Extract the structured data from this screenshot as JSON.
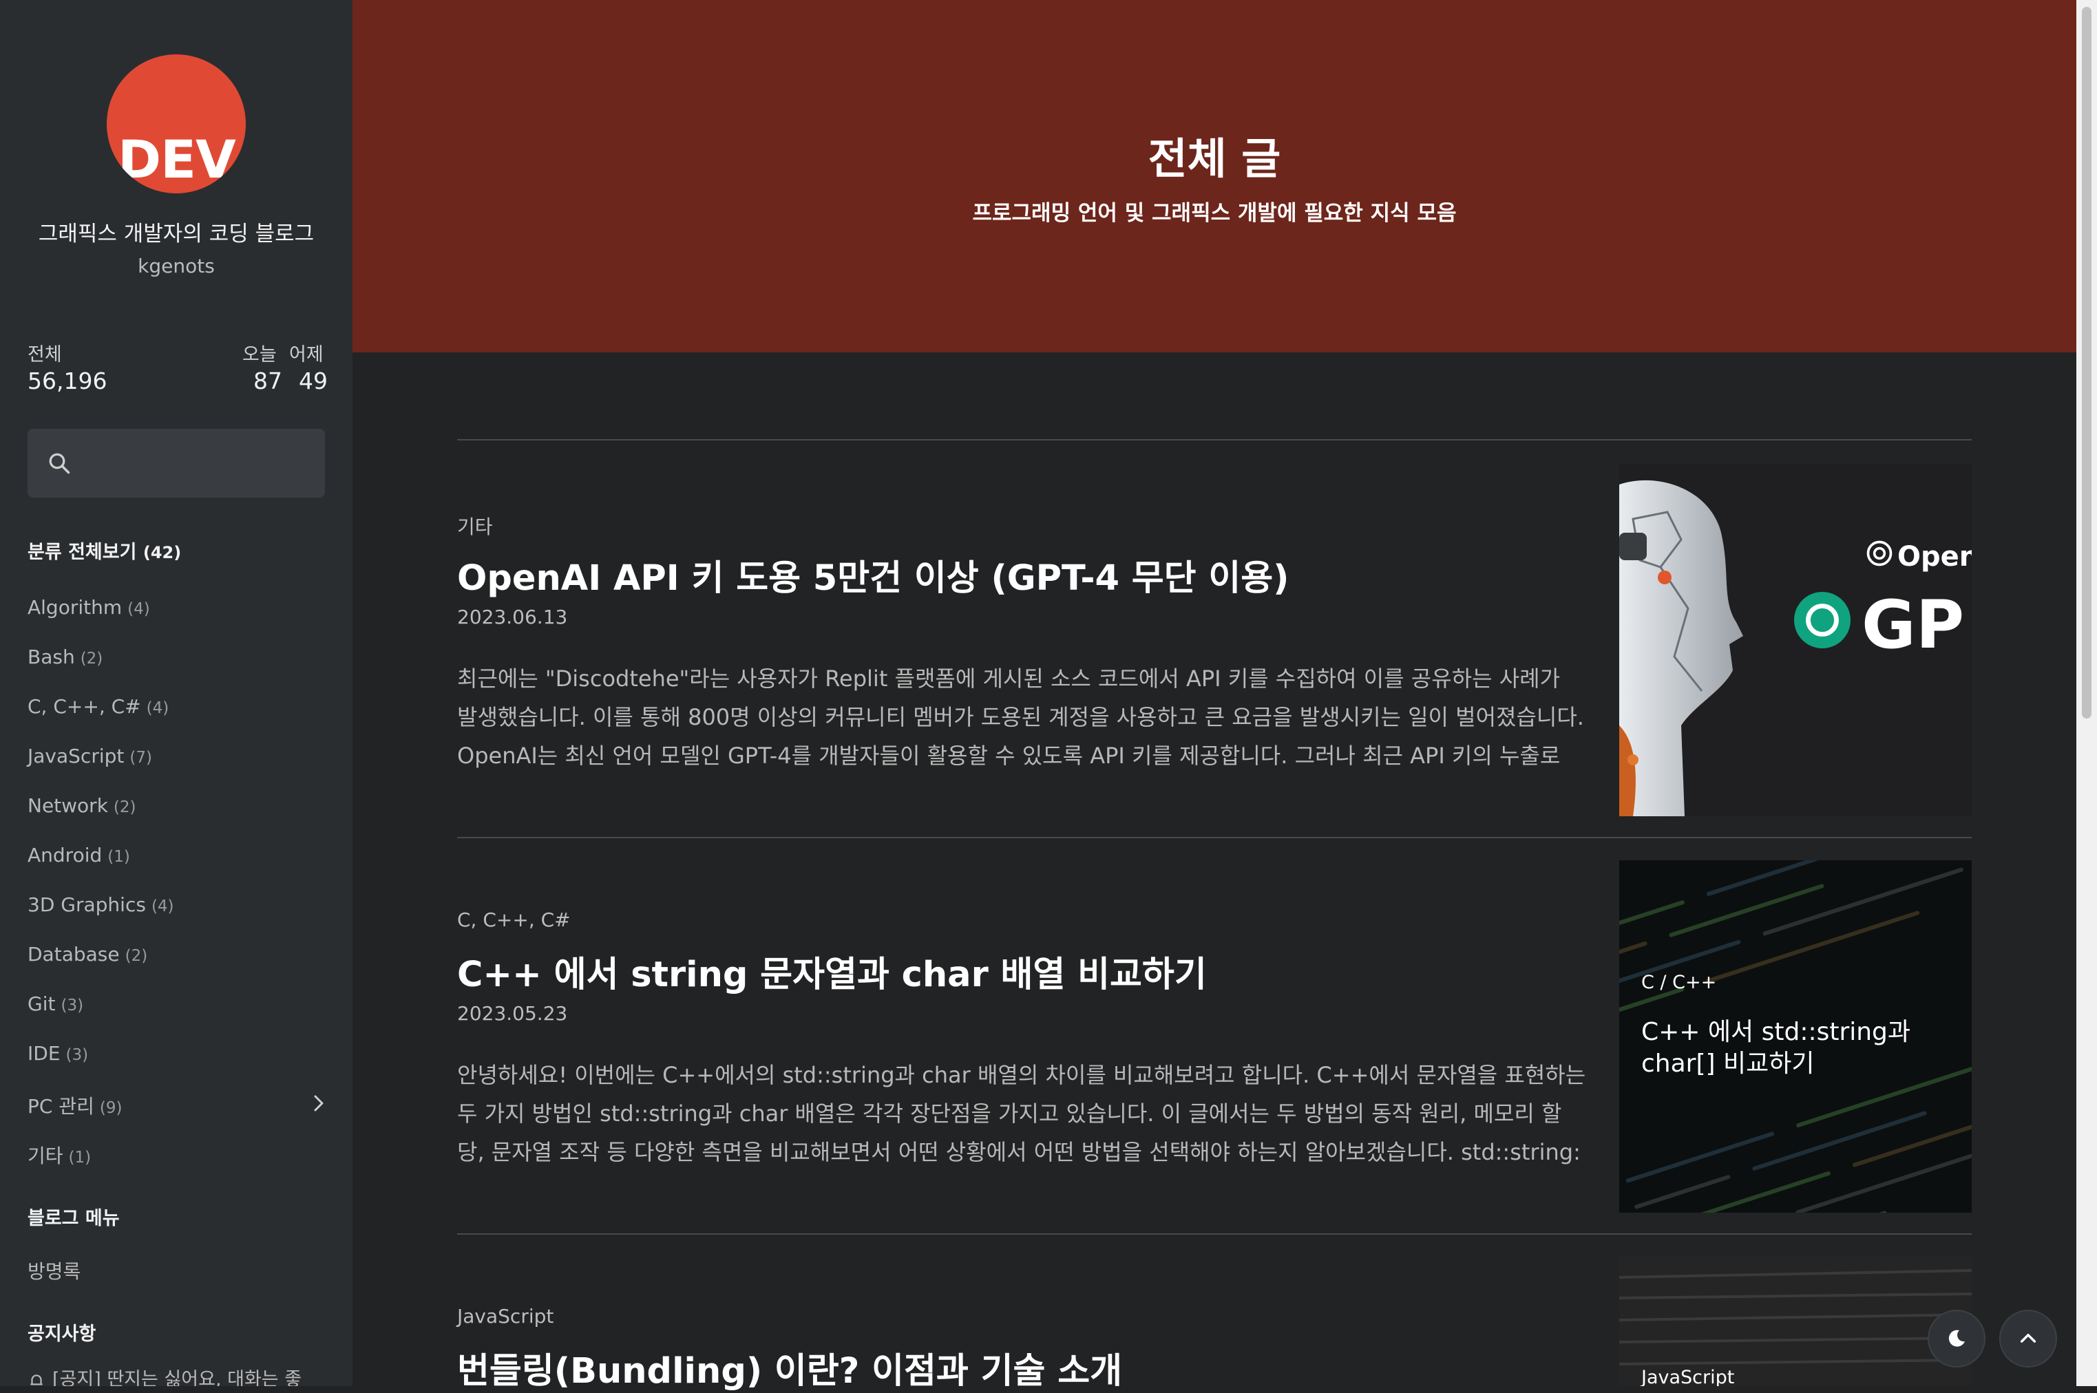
{
  "sidebar": {
    "logo_text": "DEV",
    "blog_title": "그래픽스 개발자의 코딩 블로그",
    "author": "kgenots",
    "stats": {
      "total_label": "전체",
      "total_value": "56,196",
      "today_label": "오늘",
      "today_value": "87",
      "yesterday_label": "어제",
      "yesterday_value": "49"
    },
    "search_icon": "search-icon",
    "categories_header": "분류 전체보기",
    "categories_total": "(42)",
    "categories": [
      {
        "name": "Algorithm",
        "count": "(4)"
      },
      {
        "name": "Bash",
        "count": "(2)"
      },
      {
        "name": "C, C++, C#",
        "count": "(4)"
      },
      {
        "name": "JavaScript",
        "count": "(7)"
      },
      {
        "name": "Network",
        "count": "(2)"
      },
      {
        "name": "Android",
        "count": "(1)"
      },
      {
        "name": "3D Graphics",
        "count": "(4)"
      },
      {
        "name": "Database",
        "count": "(2)"
      },
      {
        "name": "Git",
        "count": "(3)"
      },
      {
        "name": "IDE",
        "count": "(3)"
      },
      {
        "name": "PC 관리",
        "count": "(9)"
      },
      {
        "name": "기타",
        "count": "(1)"
      }
    ],
    "menu_header": "블로그 메뉴",
    "menu_items": [
      "방명록"
    ],
    "notice_header": "공지사항",
    "notice_item": "[공지] 딴지는 싫어요, 대화는 좋"
  },
  "header": {
    "title": "전체 글",
    "subtitle": "프로그래밍 언어 및 그래픽스 개발에 필요한 지식 모음",
    "color": "#6d261c"
  },
  "posts": [
    {
      "category": "기타",
      "title": "OpenAI API 키 도용 5만건 이상 (GPT-4 무단 이용)",
      "date": "2023.06.13",
      "excerpt": "최근에는 \"Discodtehe\"라는 사용자가 Replit 플랫폼에 게시된 소스 코드에서 API 키를 수집하여 이를 공유하는 사례가 발생했습니다. 이를 통해 800명 이상의 커뮤니티 멤버가 도용된 계정을 사용하고 큰 요금을 발생시키는 일이 벌어졌습니다. OpenAI는 최신 언어 모델인 GPT-4를 개발자들이 활용할 수 있도록 API 키를 제공합니다. 그러나 최근 API 키의 누출로 인해 보",
      "thumb_text_1": "Open",
      "thumb_text_2": "GP"
    },
    {
      "category": "C, C++, C#",
      "title": "C++ 에서 string 문자열과 char 배열 비교하기",
      "date": "2023.05.23",
      "excerpt": "안녕하세요! 이번에는 C++에서의 std::string과 char 배열의 차이를 비교해보려고 합니다. C++에서 문자열을 표현하는 두 가지 방법인 std::string과 char 배열은 각각 장단점을 가지고 있습니다. 이 글에서는 두 방법의 동작 원리, 메모리 할당, 문자열 조작 등 다양한 측면을 비교해보면서 어떤 상황에서 어떤 방법을 선택해야 하는지 알아보겠습니다. std::string: 유연하고 편",
      "thumb_label": "C / C++",
      "thumb_title_1": "C++ 에서 std::string과",
      "thumb_title_2": "char[] 비교하기"
    },
    {
      "category": "JavaScript",
      "title": "번들링(Bundling) 이란? 이점과 기술 소개",
      "thumb_label": "JavaScript"
    }
  ],
  "floating": {
    "dark_mode_icon": "moon-icon",
    "top_icon": "chevron-up-icon"
  }
}
